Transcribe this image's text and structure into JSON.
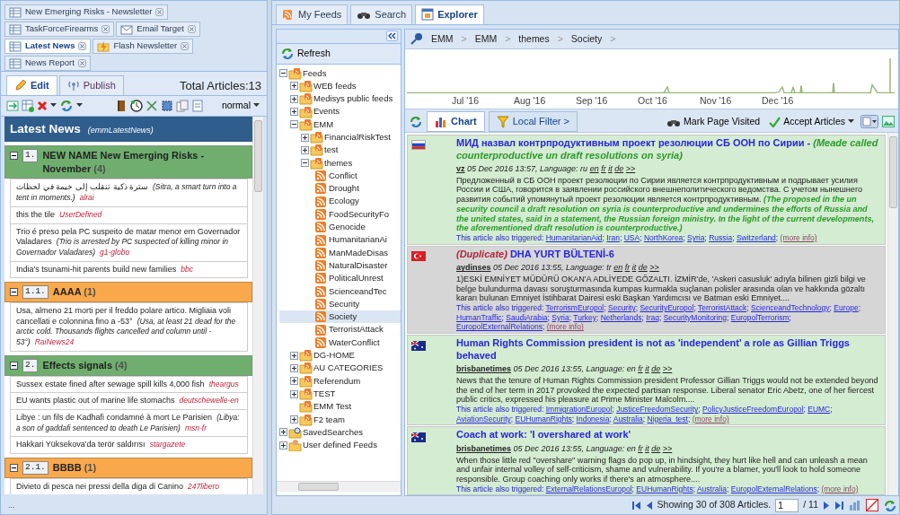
{
  "left_panel": {
    "tabs": [
      {
        "label": "New Emerging Risks - Newsletter",
        "kind": "table",
        "selected": false
      },
      {
        "label": "TaskForceFirearms",
        "kind": "table",
        "selected": false
      },
      {
        "label": "Email Target",
        "kind": "email",
        "selected": false
      },
      {
        "label": "Latest News",
        "kind": "table",
        "selected": true
      },
      {
        "label": "Flash Newsletter",
        "kind": "flash",
        "selected": false
      },
      {
        "label": "News Report",
        "kind": "table",
        "selected": false
      }
    ],
    "mode_tabs": [
      {
        "label": "Edit",
        "kind": "edit",
        "selected": true
      },
      {
        "label": "Publish",
        "kind": "publish",
        "selected": false
      }
    ],
    "total_articles": "Total Articles:13",
    "view_mode": "normal",
    "header": {
      "title": "Latest News",
      "code": "(emmLatestNews)"
    },
    "sections": [
      {
        "kind": "main",
        "expanded": true,
        "number": "1.",
        "title": "NEW NAME New Emerging Risks - November",
        "count": "(4)",
        "items": [
          {
            "text": "سترة ذكية تنقلب إلى خيمة في لحظات",
            "translation": "(Sitra, a smart turn into a tent in moments.)",
            "source": "alrai"
          },
          {
            "text": "this the tile",
            "source": "UserDefined"
          },
          {
            "text": "Trio é preso pela PC suspeito de matar menor em Governador Valadares",
            "translation": "(Trio is arrested by PC suspected of killing minor in Governador Valadares)",
            "source": "g1-globo"
          },
          {
            "text": "India's tsunami-hit parents build new families",
            "source": "bbc"
          }
        ]
      },
      {
        "kind": "sub",
        "expanded": true,
        "number": "1.1.",
        "title": "AAAA",
        "count": "(1)",
        "items": [
          {
            "text": "Usa, almeno 21 morti per il freddo polare artico. Migliaia voli cancellati e colonnina fino a -53°",
            "translation": "(Usa, at least 21 dead for the arctic cold. Thousands flights cancelled and column until - 53°)",
            "source": "RaiNews24"
          }
        ]
      },
      {
        "kind": "main",
        "expanded": true,
        "number": "2.",
        "title": "Effects signals",
        "count": "(4)",
        "items": [
          {
            "text": "Sussex estate fined after sewage spill kills 4,000 fish",
            "source": "theargus"
          },
          {
            "text": "EU wants plastic out of marine life stomachs",
            "source": "deutschewelle-en"
          },
          {
            "text": "Libye : un fils de Kadhafi condamné à mort Le Parisien",
            "translation": "(Libya: a son of gaddafi sentenced to death Le Parisien)",
            "source": "msn-fr"
          },
          {
            "text": "Hakkari Yüksekova'da terör saldırısı",
            "source": "stargazete"
          }
        ]
      },
      {
        "kind": "sub",
        "expanded": true,
        "number": "2.1.",
        "title": "BBBB",
        "count": "(1)",
        "items": [
          {
            "text": "Divieto di pesca nei pressi della diga di Canino",
            "source": "247libero"
          }
        ]
      }
    ],
    "status_text": "..."
  },
  "explorer_tabs": [
    {
      "label": "My Feeds",
      "kind": "feeds",
      "selected": false
    },
    {
      "label": "Search",
      "kind": "search",
      "selected": false
    },
    {
      "label": "Explorer",
      "kind": "explorer",
      "selected": true
    }
  ],
  "tree": {
    "refresh": "Refresh",
    "items": [
      {
        "label": "Feeds",
        "kind": "folder",
        "expanded": true,
        "selected": false,
        "children": [
          {
            "label": "WEB feeds",
            "kind": "folder",
            "expanded": false,
            "selected": false
          },
          {
            "label": "Medisys public feeds",
            "kind": "folder",
            "expanded": false,
            "selected": false
          },
          {
            "label": "Events",
            "kind": "folder",
            "expanded": false,
            "selected": false
          },
          {
            "label": "EMM",
            "kind": "folder",
            "expanded": true,
            "selected": false,
            "children": [
              {
                "label": "FinancialRiskTest",
                "kind": "folder",
                "expanded": false,
                "selected": false
              },
              {
                "label": "test",
                "kind": "folder",
                "expanded": false,
                "selected": false
              },
              {
                "label": "themes",
                "kind": "folder",
                "expanded": true,
                "selected": false,
                "children": [
                  {
                    "label": "Conflict",
                    "kind": "feed",
                    "selected": false
                  },
                  {
                    "label": "Drought",
                    "kind": "feed",
                    "selected": false
                  },
                  {
                    "label": "Ecology",
                    "kind": "feed",
                    "selected": false
                  },
                  {
                    "label": "FoodSecurityFo",
                    "kind": "feed",
                    "selected": false
                  },
                  {
                    "label": "Genocide",
                    "kind": "feed",
                    "selected": false
                  },
                  {
                    "label": "HumanitarianAi",
                    "kind": "feed",
                    "selected": false
                  },
                  {
                    "label": "ManMadeDisas",
                    "kind": "feed",
                    "selected": false
                  },
                  {
                    "label": "NaturalDisaster",
                    "kind": "feed",
                    "selected": false
                  },
                  {
                    "label": "PoliticalUnrest",
                    "kind": "feed",
                    "selected": false
                  },
                  {
                    "label": "ScienceandTec",
                    "kind": "feed",
                    "selected": false
                  },
                  {
                    "label": "Security",
                    "kind": "feed",
                    "selected": false
                  },
                  {
                    "label": "Society",
                    "kind": "feed",
                    "selected": true
                  },
                  {
                    "label": "TerroristAttack",
                    "kind": "feed",
                    "selected": false
                  },
                  {
                    "label": "WaterConflict",
                    "kind": "feed",
                    "selected": false
                  }
                ]
              }
            ]
          },
          {
            "label": "DG-HOME",
            "kind": "folder",
            "expanded": false,
            "selected": false
          },
          {
            "label": "AU CATEGORIES",
            "kind": "folder",
            "expanded": false,
            "selected": false
          },
          {
            "label": "Referendum",
            "kind": "folder",
            "expanded": false,
            "selected": false
          },
          {
            "label": "TEST",
            "kind": "folder",
            "expanded": false,
            "selected": false
          },
          {
            "label": "EMM Test",
            "kind": "folder",
            "selected": false
          },
          {
            "label": "F2 team",
            "kind": "folder",
            "expanded": false,
            "selected": false
          }
        ]
      },
      {
        "label": "SavedSearches",
        "kind": "saved",
        "expanded": false,
        "selected": false
      },
      {
        "label": "User defined Feeds",
        "kind": "user",
        "expanded": false,
        "selected": false
      }
    ]
  },
  "explorer": {
    "breadcrumb": {
      "items": [
        "EMM",
        "EMM",
        "themes",
        "Society"
      ],
      "separator": ">"
    },
    "timeline": {
      "labels": [
        "Jul '16",
        "Aug '16",
        "Sep '16",
        "Oct '16",
        "Nov '16",
        "Dec '16"
      ]
    },
    "view_tabs": [
      {
        "label": "Chart",
        "kind": "chart",
        "selected": true
      },
      {
        "label": "Local Filter >",
        "kind": "filter",
        "selected": false
      }
    ],
    "tag_separator": ";",
    "actions": [
      {
        "label": "Mark Page Visited",
        "kind": "visited"
      },
      {
        "label": "Accept Articles",
        "kind": "accept"
      }
    ],
    "articles": [
      {
        "kind": "ru",
        "duplicate": false,
        "title": "МИД назвал контрпродуктивным проект резолюции СБ ООН по Сирии -",
        "title_translation": "(Meade called counterproductive un draft resolutions on syria)",
        "source": "vz",
        "date": "05 Dec 2016 13:57, Language: ru",
        "languages": [
          "en",
          "fr",
          "it",
          "de",
          ">>"
        ],
        "body": "Предложенный в СБ ООН проект резолюции по Сирии является контрпродуктивным и подрывает усилия России и США, говорится в заявлении российского внешнеполитического ведомства. С учетом нынешнего развития событий упомянутый проект резолюции является контрпродуктивным.",
        "body_translation": "(The proposed in the un security council a draft resolution on syria is counterproductive and undermines the efforts of Russia and the united states, said in a statement, the Russian foreign ministry. In the light of the current developments, the aforementioned draft resolution is counterproductive.)",
        "triggered_label": "This article also triggered:",
        "tags": [
          "HumanitarianAid",
          "Iran",
          "USA",
          "NorthKorea",
          "Syria",
          "Russia",
          "Switzerland"
        ],
        "more": "(more info)"
      },
      {
        "kind": "tr",
        "duplicate": true,
        "duplicate_label": "(Duplicate)",
        "title": "DHA YURT BÜLTENİ-6",
        "source": "aydinses",
        "date": "05 Dec 2016 13:55, Language: tr",
        "languages": [
          "en",
          "fr",
          "it",
          "de",
          ">>"
        ],
        "body": "1)ESKİ EMNİYET MÜDÜRÜ OKAN'A ADLİYEDE GÖZALTI. İZMİR'de, 'Askeri casusluk' adıyla bilinen gizli bilgi ve belge bulundurma davası soruşturmasında kumpas kurmakla suçlanan polisler arasında olan ve hakkında gözaltı kararı bulunan Emniyet İstihbarat Dairesi eski Başkan Yardımcısı ve Batman eski Emniyet....",
        "triggered_label": "This article also triggered:",
        "tags": [
          "TerrorismEuropol",
          "Security",
          "SecurityEuropol",
          "TerroristAttack",
          "ScienceandTechnology",
          "Europe",
          "HumanTraffic",
          "SaudiArabia",
          "Syria",
          "Turkey",
          "Netherlands",
          "Iraq",
          "SecurityMonitoring",
          "EuropolTerrorism",
          "EuropolExternalRelations"
        ],
        "more": "(more info)"
      },
      {
        "kind": "au",
        "duplicate": false,
        "title": "Human Rights Commission president is not as 'independent' a role as Gillian Triggs behaved",
        "source": "brisbanetimes",
        "date": "05 Dec 2016 13:55, Language: en",
        "languages": [
          "fr",
          "it",
          "de",
          ">>"
        ],
        "body": "News that the tenure of Human Rights Commission president Professor Gillian Triggs would not be extended beyond the end of her term in 2017 provoked the expected partisan response. Liberal senator Eric Abetz, one of her fiercest public critics, expressed his pleasure at Prime Minister Malcolm....",
        "triggered_label": "This article also triggered:",
        "tags": [
          "ImmigrationEuropol",
          "JusticeFreedomSecurity",
          "PolicyJusticeFreedomEuropol",
          "EUMC",
          "AviationSecurity",
          "EUHumanRights",
          "Indonesia",
          "Australia",
          "Nigeria_test"
        ],
        "more": "(more info)"
      },
      {
        "kind": "au",
        "duplicate": false,
        "title": "Coach at work: 'I overshared at work'",
        "source": "brisbanetimes",
        "date": "05 Dec 2016 13:55, Language: en",
        "languages": [
          "fr",
          "it",
          "de",
          ">>"
        ],
        "body": "When those little red \"overshare\" warning flags do pop up, in hindsight, they hurt like hell and can unleash a mean and unfair internal volley of self-criticism, shame and vulnerability. If you're a blamer, you'll look to hold someone responsible. Group coaching only works if there's an atmosphere....",
        "triggered_label": "This article also triggered:",
        "tags": [
          "ExternalRelationsEuropol",
          "EUHumanRights",
          "Australia",
          "EuropolExternalRelations"
        ],
        "more": "(more info)"
      }
    ],
    "pager": {
      "summary": "Showing 30 of 308 Articles.",
      "page": "1",
      "total": "/ 11"
    }
  }
}
